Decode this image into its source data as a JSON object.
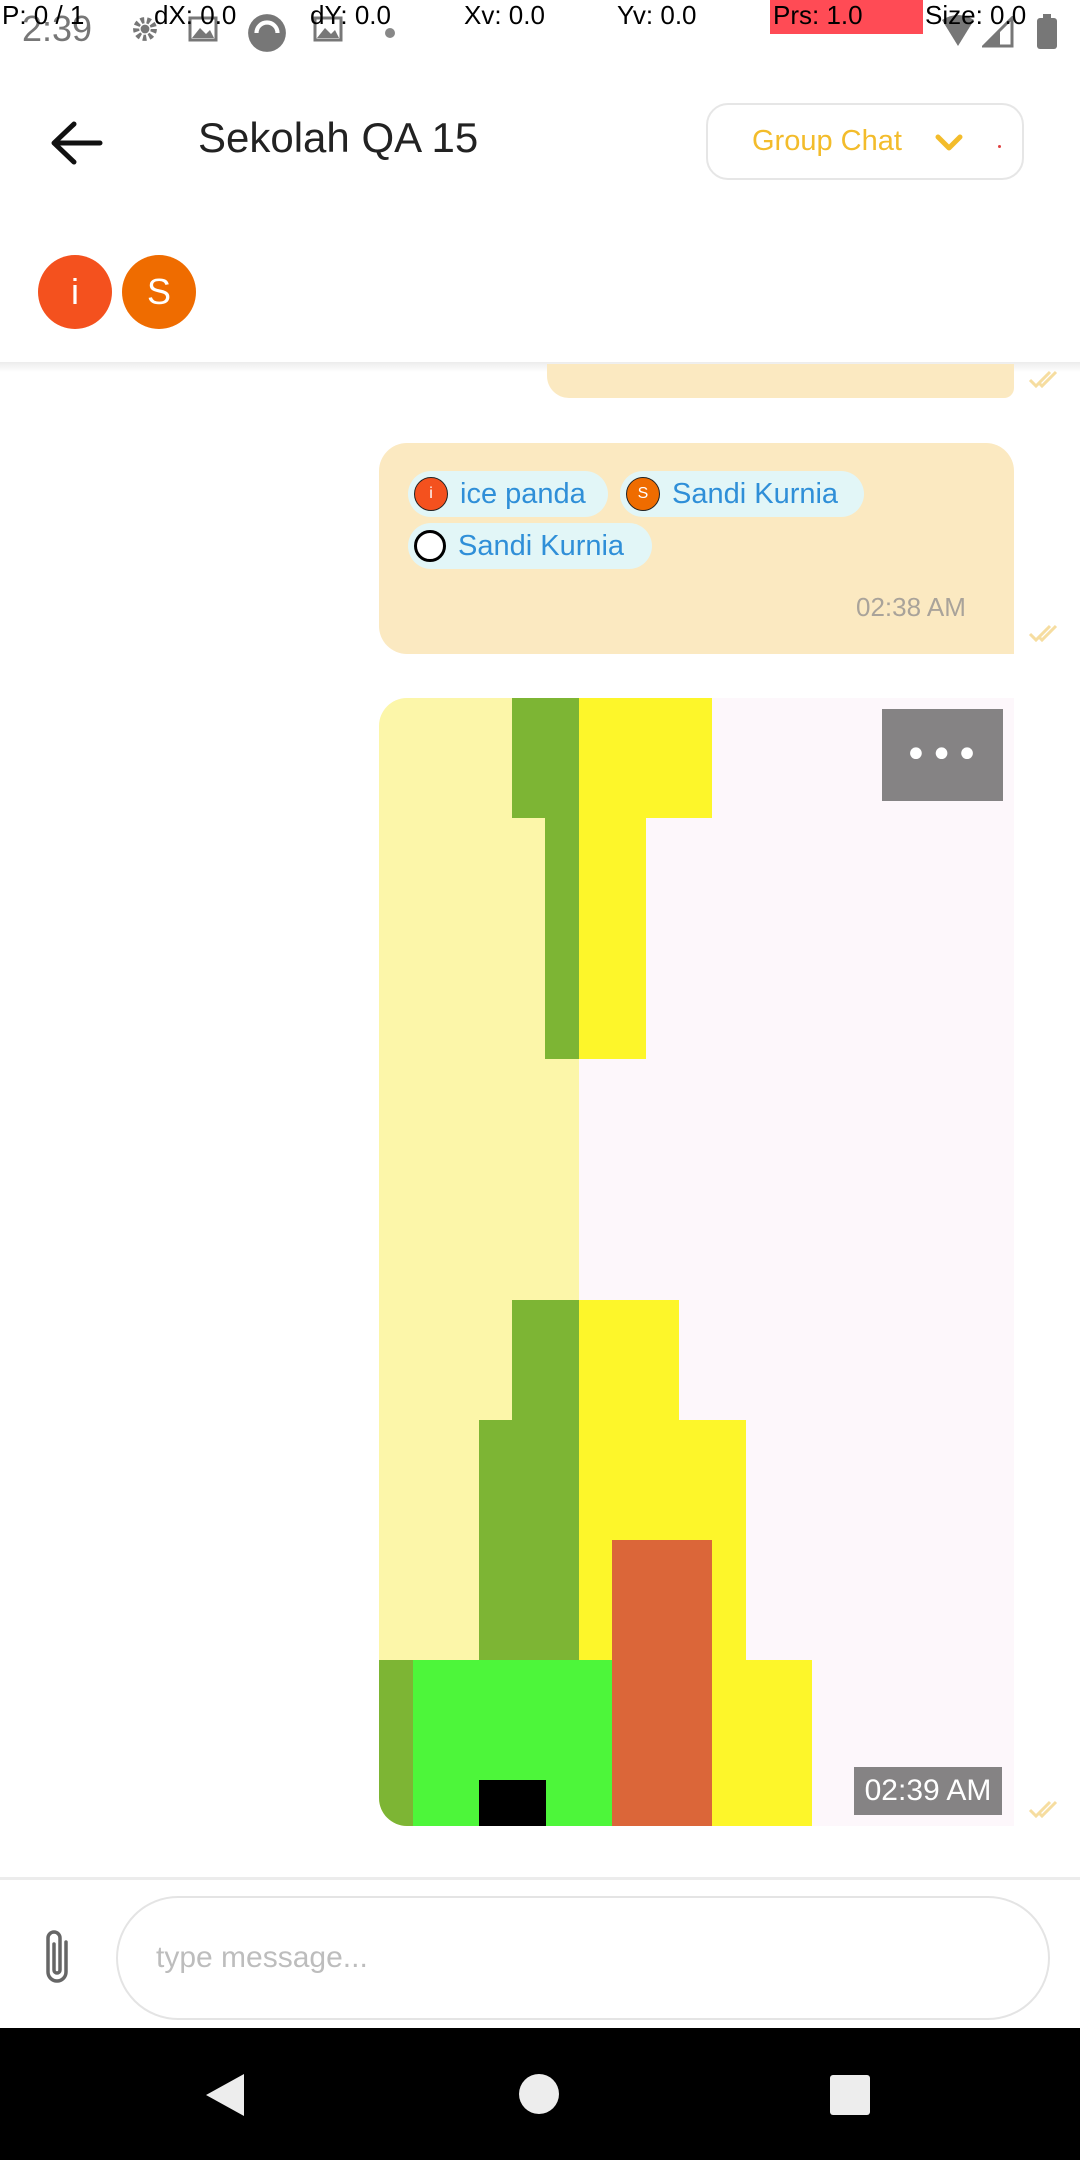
{
  "status_bar": {
    "clock": "2:39",
    "debug": {
      "pointer": "P: 0 / 1",
      "dx": "dX: 0.0",
      "dy": "dY: 0.0",
      "xv": "Xv: 0.0",
      "yv": "Yv: 0.0",
      "prs": "Prs: 1.0",
      "size": "Size: 0.0"
    },
    "icons": [
      "gear-icon",
      "gallery-icon",
      "sync-icon",
      "gallery-icon",
      "dot-icon",
      "wifi-icon",
      "signal-icon",
      "battery-icon"
    ]
  },
  "header": {
    "back_icon": "arrow-left-icon",
    "title": "Sekolah QA 15",
    "dropdown": {
      "label": "Group Chat",
      "icon": "chevron-down-icon"
    },
    "participants": [
      {
        "initial": "i",
        "color": "#f4511e"
      },
      {
        "initial": "S",
        "color": "#ef6c00"
      }
    ]
  },
  "messages": [
    {
      "type": "mentions",
      "mentions": [
        {
          "avatar_initial": "i",
          "avatar_color": "#f4511e",
          "label": "ice panda"
        },
        {
          "avatar_initial": "S",
          "avatar_color": "#ef6c00",
          "label": "Sandi Kurnia"
        },
        {
          "avatar_initial": "",
          "avatar_color": "#000000",
          "label": "Sandi Kurnia"
        }
      ],
      "time": "02:38 AM"
    },
    {
      "type": "image",
      "more_label": "•••",
      "time": "02:39 AM"
    }
  ],
  "composer": {
    "attach_icon": "paperclip-icon",
    "placeholder": "type message..."
  },
  "nav_bar": {
    "back_icon": "nav-back-icon",
    "home_icon": "nav-home-icon",
    "recents_icon": "nav-recents-icon"
  },
  "colors": {
    "accent": "#f3bc2b",
    "bubble": "#fbe9c1",
    "mention_chip": "#e2f6f7",
    "mention_text": "#2f8fd8"
  }
}
